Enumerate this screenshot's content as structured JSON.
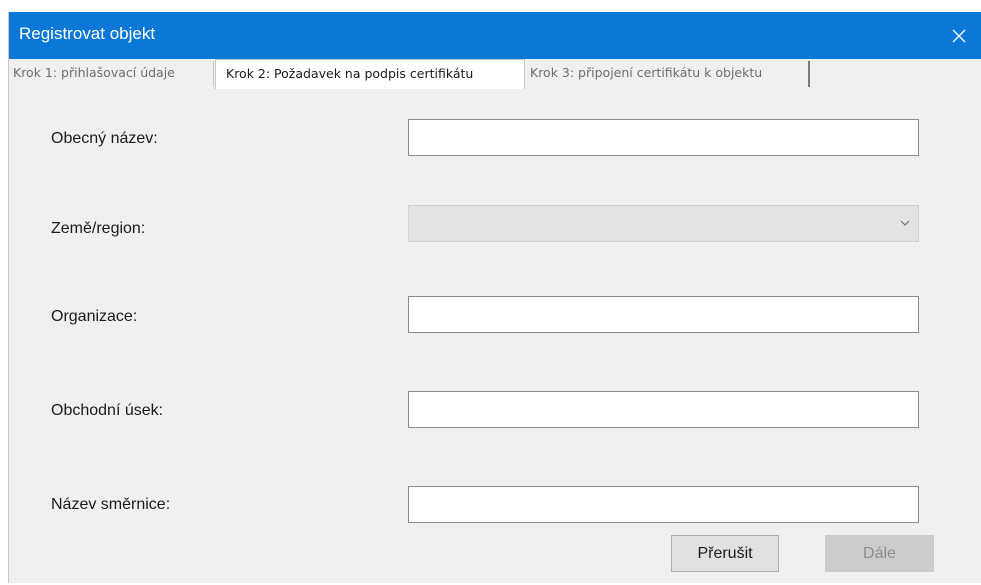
{
  "window": {
    "title": "Registrovat objekt",
    "close_icon": "close-icon"
  },
  "tabs": [
    {
      "label": "Krok 1: přihlašovací údaje",
      "selected": false
    },
    {
      "label": "Krok 2: Požadavek na podpis certifikátu",
      "selected": true
    },
    {
      "label": "Krok 3: připojení certifikátu k objektu",
      "selected": false
    }
  ],
  "form": {
    "common_name": {
      "label": "Obecný název:",
      "value": ""
    },
    "country": {
      "label": "Země/region:",
      "value": "",
      "disabled": true
    },
    "organization": {
      "label": "Organizace:",
      "value": ""
    },
    "business_unit": {
      "label": "Obchodní úsek:",
      "value": ""
    },
    "policy_name": {
      "label": "Název směrnice:",
      "value": ""
    }
  },
  "buttons": {
    "cancel_label": "Přerušit",
    "next_label": "Dále"
  },
  "colors": {
    "titlebar": "#0b78d7",
    "dialog_bg": "#f0f0f0",
    "disabled_button": "#cccccc"
  }
}
